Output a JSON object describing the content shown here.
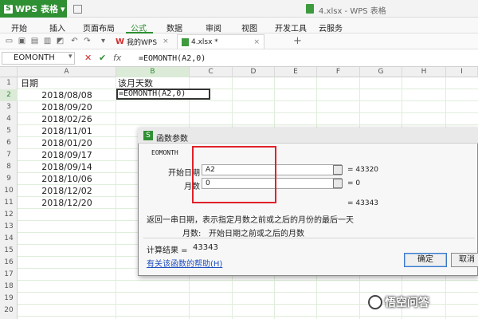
{
  "app": {
    "name": "WPS 表格",
    "title": "4.xlsx - WPS 表格"
  },
  "menu": [
    "开始",
    "插入",
    "页面布局",
    "公式",
    "数据",
    "审阅",
    "视图",
    "开发工具",
    "云服务"
  ],
  "tabs": {
    "home": "我的WPS",
    "file": "4.xlsx *"
  },
  "formula_bar": {
    "name_box": "EOMONTH",
    "formula": "=EOMONTH(A2,0)"
  },
  "columns": [
    "A",
    "B",
    "C",
    "D",
    "E",
    "F",
    "G",
    "H",
    "I"
  ],
  "rows": [
    "1",
    "2",
    "3",
    "4",
    "5",
    "6",
    "7",
    "8",
    "9",
    "10",
    "11",
    "12",
    "13",
    "14",
    "15",
    "16",
    "17",
    "18",
    "19",
    "20"
  ],
  "cells": {
    "a1": "日期",
    "b1": "该月天数",
    "b2": "=EOMONTH(A2,0)",
    "dates": [
      "2018/08/08",
      "2018/09/20",
      "2018/02/26",
      "2018/11/01",
      "2018/01/20",
      "2018/09/17",
      "2018/09/14",
      "2018/10/06",
      "2018/12/02",
      "2018/12/20"
    ]
  },
  "dialog": {
    "title": "函数参数",
    "function": "EOMONTH",
    "params": [
      {
        "label": "开始日期",
        "value": "A2",
        "result": "= 43320"
      },
      {
        "label": "月数",
        "value": "0",
        "result": "= 0"
      }
    ],
    "total_result": "= 43343",
    "description": "返回一串日期，表示指定月数之前或之后的月份的最后一天",
    "param_desc_label": "月数:",
    "param_desc": "开始日期之前或之后的月数",
    "calc_label": "计算结果 =",
    "calc_value": "43343",
    "help": "有关该函数的帮助(H)",
    "ok": "确定",
    "cancel": "取消"
  },
  "watermark": "悟空问答"
}
